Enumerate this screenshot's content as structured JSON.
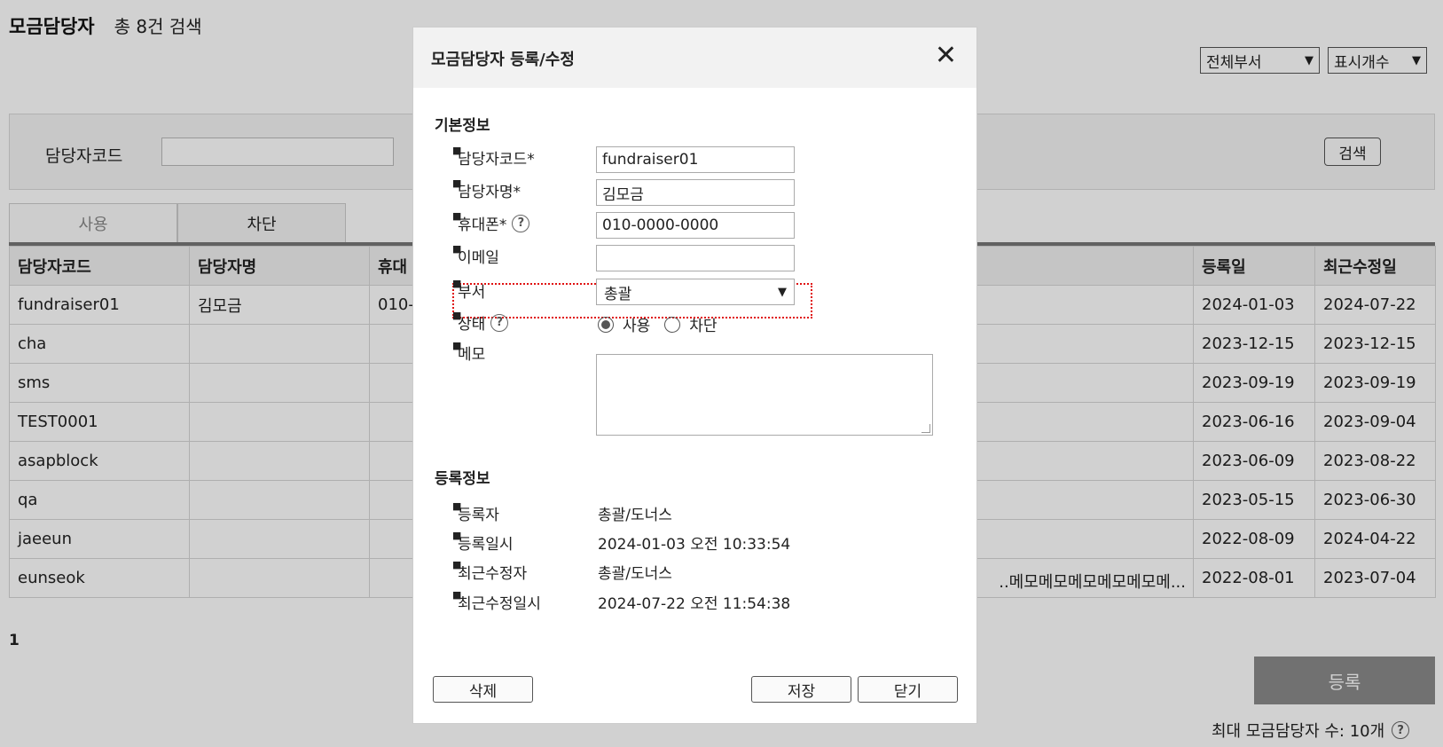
{
  "page": {
    "title": "모금담당자",
    "result_count": "총 8건 검색",
    "department_filter": "전체부서",
    "display_count": "표시개수"
  },
  "search": {
    "label": "담당자코드",
    "value": "",
    "button": "검색"
  },
  "tabs": [
    {
      "label": "사용",
      "active": true
    },
    {
      "label": "차단",
      "active": false
    }
  ],
  "table": {
    "headers": [
      "담당자코드",
      "담당자명",
      "휴대",
      "등록일",
      "최근수정일"
    ],
    "rows": [
      {
        "code": "fundraiser01",
        "name": "김모금",
        "phone": "010-",
        "memo": "",
        "reg": "2024-01-03",
        "mod": "2024-07-22"
      },
      {
        "code": "cha",
        "name": "",
        "phone": "",
        "memo": "",
        "reg": "2023-12-15",
        "mod": "2023-12-15"
      },
      {
        "code": "sms",
        "name": "",
        "phone": "",
        "memo": "",
        "reg": "2023-09-19",
        "mod": "2023-09-19"
      },
      {
        "code": "TEST0001",
        "name": "",
        "phone": "",
        "memo": "",
        "reg": "2023-06-16",
        "mod": "2023-09-04"
      },
      {
        "code": "asapblock",
        "name": "",
        "phone": "",
        "memo": "",
        "reg": "2023-06-09",
        "mod": "2023-08-22"
      },
      {
        "code": "qa",
        "name": "",
        "phone": "",
        "memo": "",
        "reg": "2023-05-15",
        "mod": "2023-06-30"
      },
      {
        "code": "jaeeun",
        "name": "",
        "phone": "",
        "memo": "",
        "reg": "2022-08-09",
        "mod": "2024-04-22"
      },
      {
        "code": "eunseok",
        "name": "",
        "phone": "",
        "memo": "..메모메모메모메모메모메...",
        "reg": "2022-08-01",
        "mod": "2023-07-04"
      }
    ]
  },
  "pager": {
    "current": "1"
  },
  "register_button": "등록",
  "max_note": "최대 모금담당자 수: 10개",
  "modal": {
    "title": "모금담당자 등록/수정",
    "basic_section": "기본정보",
    "fields": {
      "code_label": "담당자코드*",
      "code_value": "fundraiser01",
      "name_label": "담당자명*",
      "name_value": "김모금",
      "phone_label": "휴대폰*",
      "phone_value": "010-0000-0000",
      "email_label": "이메일",
      "email_value": "",
      "dept_label": "부서",
      "dept_value": "총괄",
      "status_label": "상태",
      "status_use": "사용",
      "status_block": "차단",
      "status_selected": "사용",
      "memo_label": "메모",
      "memo_value": ""
    },
    "reg_section": "등록정보",
    "reg_info": {
      "registrant_label": "등록자",
      "registrant_value": "총괄/도너스",
      "reg_time_label": "등록일시",
      "reg_time_value": "2024-01-03 오전 10:33:54",
      "modifier_label": "최근수정자",
      "modifier_value": "총괄/도너스",
      "mod_time_label": "최근수정일시",
      "mod_time_value": "2024-07-22 오전 11:54:38"
    },
    "buttons": {
      "delete": "삭제",
      "save": "저장",
      "close": "닫기"
    }
  }
}
